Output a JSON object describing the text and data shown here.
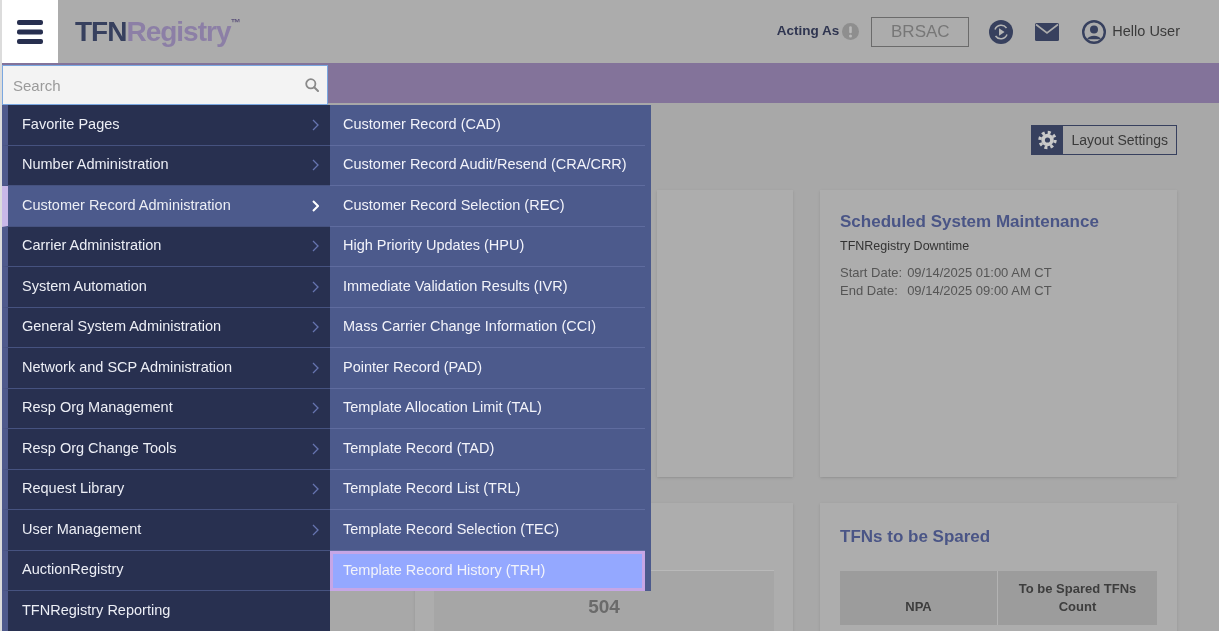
{
  "header": {
    "logo": {
      "dark_part": "TFN",
      "light_part": "Registry",
      "trademark": "™"
    },
    "acting_as": {
      "label": "Acting As",
      "value": "BRSAC"
    },
    "greeting": "Hello User"
  },
  "search": {
    "placeholder": "Search"
  },
  "menu": {
    "items": [
      {
        "label": "Favorite Pages",
        "has_submenu": true,
        "selected": false
      },
      {
        "label": "Number Administration",
        "has_submenu": true,
        "selected": false
      },
      {
        "label": "Customer Record Administration",
        "has_submenu": true,
        "selected": true
      },
      {
        "label": "Carrier Administration",
        "has_submenu": true,
        "selected": false
      },
      {
        "label": "System Automation",
        "has_submenu": true,
        "selected": false
      },
      {
        "label": "General System Administration",
        "has_submenu": true,
        "selected": false
      },
      {
        "label": "Network and SCP Administration",
        "has_submenu": true,
        "selected": false
      },
      {
        "label": "Resp Org Management",
        "has_submenu": true,
        "selected": false
      },
      {
        "label": "Resp Org Change Tools",
        "has_submenu": true,
        "selected": false
      },
      {
        "label": "Request Library",
        "has_submenu": true,
        "selected": false
      },
      {
        "label": "User Management",
        "has_submenu": true,
        "selected": false
      },
      {
        "label": "AuctionRegistry",
        "has_submenu": false,
        "selected": false
      },
      {
        "label": "TFNRegistry Reporting",
        "has_submenu": false,
        "selected": false
      }
    ]
  },
  "submenu": {
    "items": [
      {
        "label": "Customer Record (CAD)",
        "selected": false
      },
      {
        "label": "Customer Record Audit/Resend (CRA/CRR)",
        "selected": false
      },
      {
        "label": "Customer Record Selection (REC)",
        "selected": false
      },
      {
        "label": "High Priority Updates (HPU)",
        "selected": false
      },
      {
        "label": "Immediate Validation Results (IVR)",
        "selected": false
      },
      {
        "label": "Mass Carrier Change Information (CCI)",
        "selected": false
      },
      {
        "label": "Pointer Record (PAD)",
        "selected": false
      },
      {
        "label": "Template Allocation Limit (TAL)",
        "selected": false
      },
      {
        "label": "Template Record (TAD)",
        "selected": false
      },
      {
        "label": "Template Record List (TRL)",
        "selected": false
      },
      {
        "label": "Template Record Selection (TEC)",
        "selected": false
      },
      {
        "label": "Template Record History (TRH)",
        "selected": true
      }
    ]
  },
  "layout_settings": {
    "label": "Layout Settings"
  },
  "maintenance_card": {
    "title": "Scheduled System Maintenance",
    "subtitle": "TFNRegistry Downtime",
    "dates": [
      {
        "label": "Start Date:",
        "value": "09/14/2025 01:00 AM CT"
      },
      {
        "label": "End Date:",
        "value": "09/14/2025 09:00 AM CT"
      }
    ]
  },
  "stat_card": {
    "value": "504"
  },
  "spared_card": {
    "title": "TFNs to be Spared",
    "table": {
      "columns": [
        "NPA",
        "To be Spared TFNs Count"
      ]
    }
  }
}
